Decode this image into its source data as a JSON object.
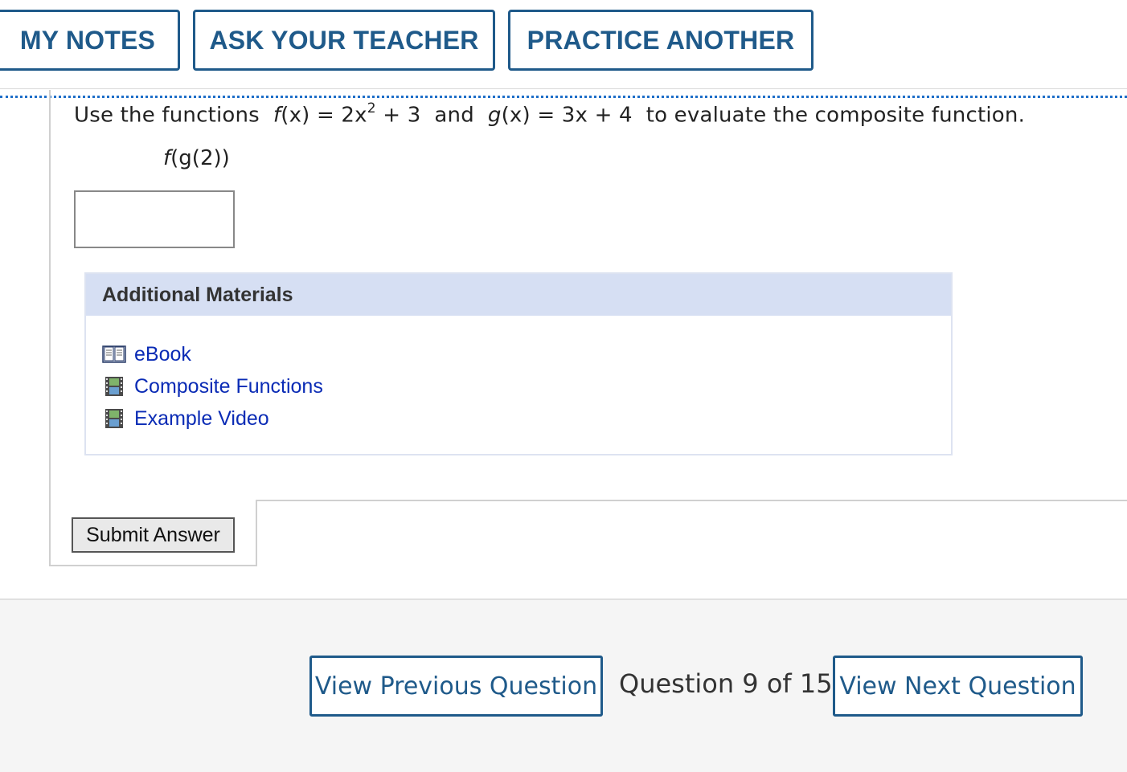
{
  "toolbar": {
    "my_notes": "MY NOTES",
    "ask_teacher": "ASK YOUR TEACHER",
    "practice_another": "PRACTICE ANOTHER"
  },
  "question": {
    "prefix": "Use the functions",
    "f_name": "f",
    "f_arg": "(x)",
    "f_eq": " = 2x",
    "f_exp": "2",
    "f_tail": " + 3",
    "and": "and",
    "g_name": "g",
    "g_arg": "(x)",
    "g_eq": " = 3x + 4",
    "suffix": "to evaluate the composite function.",
    "expression_outer": "f",
    "expression_inner": "(g(",
    "expression_num": "2",
    "expression_close": "))",
    "answer_value": ""
  },
  "materials": {
    "header": "Additional Materials",
    "items": [
      {
        "label": "eBook",
        "icon": "book-icon"
      },
      {
        "label": "Composite Functions",
        "icon": "film-icon"
      },
      {
        "label": "Example Video",
        "icon": "film-icon"
      }
    ]
  },
  "submit_label": "Submit Answer",
  "footer": {
    "prev_label": "View Previous Question",
    "counter": "Question 9 of 15",
    "next_label": "View Next Question"
  },
  "colors": {
    "accent": "#1f5a8a",
    "link": "#0a2bb5",
    "materials_header_bg": "#d6dff3",
    "dotted_rule": "#1e6ec8"
  }
}
